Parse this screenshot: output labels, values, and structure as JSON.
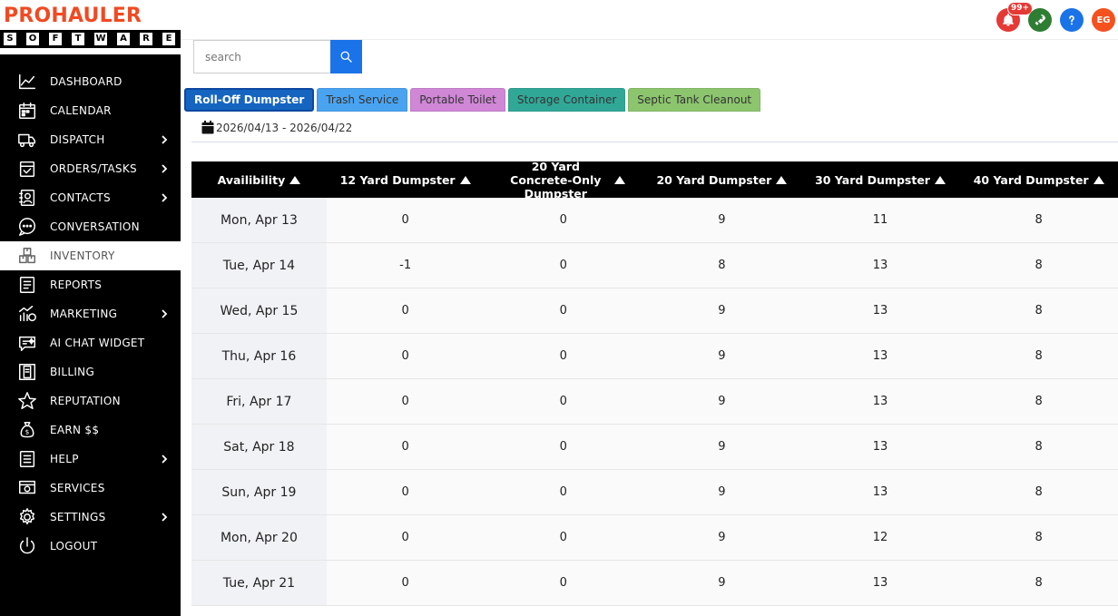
{
  "brand": {
    "name": "PROHAULER",
    "sub": [
      "S",
      "O",
      "F",
      "T",
      "W",
      "A",
      "R",
      "E"
    ],
    "color": "#f04a23"
  },
  "sidebar": {
    "items": [
      {
        "label": "DASHBOARD",
        "icon": "chart-line-icon",
        "chevron": false,
        "active": false
      },
      {
        "label": "CALENDAR",
        "icon": "calendar-icon",
        "chevron": false,
        "active": false
      },
      {
        "label": "DISPATCH",
        "icon": "truck-icon",
        "chevron": true,
        "active": false
      },
      {
        "label": "ORDERS/TASKS",
        "icon": "checklist-icon",
        "chevron": true,
        "active": false
      },
      {
        "label": "CONTACTS",
        "icon": "contact-card-icon",
        "chevron": true,
        "active": false
      },
      {
        "label": "CONVERSATION",
        "icon": "chat-bubble-icon",
        "chevron": false,
        "active": false
      },
      {
        "label": "INVENTORY",
        "icon": "boxes-icon",
        "chevron": false,
        "active": true
      },
      {
        "label": "REPORTS",
        "icon": "report-icon",
        "chevron": false,
        "active": false
      },
      {
        "label": "MARKETING",
        "icon": "marketing-icon",
        "chevron": true,
        "active": false
      },
      {
        "label": "AI CHAT WIDGET",
        "icon": "ai-chat-icon",
        "chevron": false,
        "active": false
      },
      {
        "label": "BILLING",
        "icon": "billing-icon",
        "chevron": false,
        "active": false
      },
      {
        "label": "REPUTATION",
        "icon": "star-icon",
        "chevron": false,
        "active": false
      },
      {
        "label": "EARN $$",
        "icon": "money-bag-icon",
        "chevron": false,
        "active": false
      },
      {
        "label": "HELP",
        "icon": "help-doc-icon",
        "chevron": true,
        "active": false
      },
      {
        "label": "SERVICES",
        "icon": "services-icon",
        "chevron": false,
        "active": false
      },
      {
        "label": "SETTINGS",
        "icon": "gear-icon",
        "chevron": true,
        "active": false
      },
      {
        "label": "LOGOUT",
        "icon": "power-icon",
        "chevron": false,
        "active": false
      }
    ]
  },
  "topbar": {
    "notifications_badge": "99+",
    "avatar_initials": "EG",
    "colors": {
      "bell": "#e53935",
      "rocket": "#2e7d32",
      "help": "#1a73e8",
      "avatar": "#f4511e"
    }
  },
  "search": {
    "placeholder": "search",
    "value": ""
  },
  "tabs": [
    {
      "label": "Roll-Off Dumpster",
      "color": "#1565c0",
      "active": true
    },
    {
      "label": "Trash Service",
      "color": "#4aa3f0",
      "active": false
    },
    {
      "label": "Portable Toilet",
      "color": "#cf87d6",
      "active": false
    },
    {
      "label": "Storage Container",
      "color": "#31a897",
      "active": false
    },
    {
      "label": "Septic Tank Cleanout",
      "color": "#8cc56e",
      "active": false
    }
  ],
  "date_range": "2026/04/13 - 2026/04/22",
  "table": {
    "headers": [
      "Availibility",
      "12 Yard Dumpster",
      "20 Yard Concrete-Only Dumpster",
      "20 Yard Dumpster",
      "30 Yard Dumpster",
      "40 Yard Dumpster"
    ],
    "rows": [
      [
        "Mon, Apr 13",
        "0",
        "0",
        "9",
        "11",
        "8"
      ],
      [
        "Tue, Apr 14",
        "-1",
        "0",
        "8",
        "13",
        "8"
      ],
      [
        "Wed, Apr 15",
        "0",
        "0",
        "9",
        "13",
        "8"
      ],
      [
        "Thu, Apr 16",
        "0",
        "0",
        "9",
        "13",
        "8"
      ],
      [
        "Fri, Apr 17",
        "0",
        "0",
        "9",
        "13",
        "8"
      ],
      [
        "Sat, Apr 18",
        "0",
        "0",
        "9",
        "13",
        "8"
      ],
      [
        "Sun, Apr 19",
        "0",
        "0",
        "9",
        "13",
        "8"
      ],
      [
        "Mon, Apr 20",
        "0",
        "0",
        "9",
        "12",
        "8"
      ],
      [
        "Tue, Apr 21",
        "0",
        "0",
        "9",
        "13",
        "8"
      ]
    ]
  }
}
